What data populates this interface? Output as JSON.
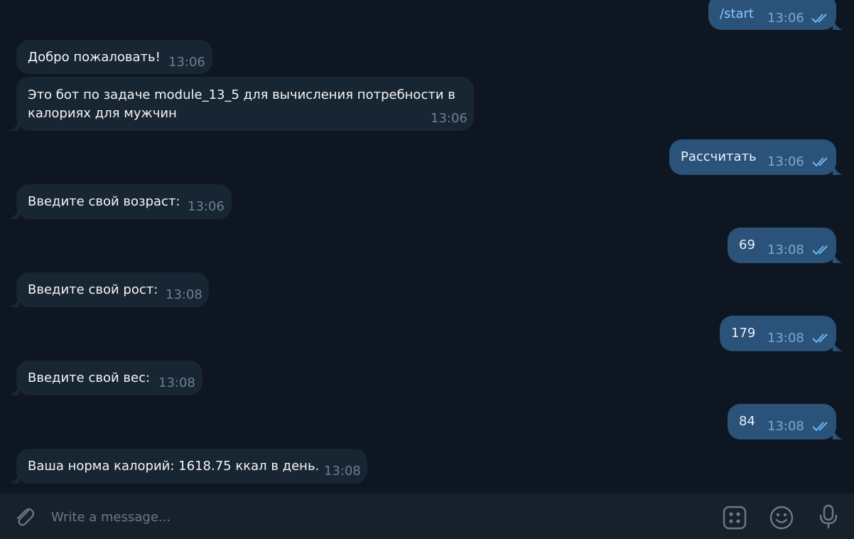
{
  "messages": [
    {
      "id": "m1",
      "dir": "out",
      "text": "/start",
      "time": "13:06",
      "is_command": true
    },
    {
      "id": "m2",
      "dir": "in",
      "text": "Добро пожаловать!",
      "time": "13:06"
    },
    {
      "id": "m3",
      "dir": "in",
      "line1": "Это бот по задаче module_13_5 для вычисления потребности в",
      "line2": "калориях для мужчин",
      "time": "13:06"
    },
    {
      "id": "m4",
      "dir": "out",
      "text": "Рассчитать",
      "time": "13:06"
    },
    {
      "id": "m5",
      "dir": "in",
      "text": "Введите свой возраст:",
      "time": "13:06"
    },
    {
      "id": "m6",
      "dir": "out",
      "text": "69",
      "time": "13:08"
    },
    {
      "id": "m7",
      "dir": "in",
      "text": "Введите свой рост:",
      "time": "13:08"
    },
    {
      "id": "m8",
      "dir": "out",
      "text": "179",
      "time": "13:08"
    },
    {
      "id": "m9",
      "dir": "in",
      "text": "Введите свой вес:",
      "time": "13:08"
    },
    {
      "id": "m10",
      "dir": "out",
      "text": "84",
      "time": "13:08"
    },
    {
      "id": "m11",
      "dir": "in",
      "text": "Ваша норма калорий: 1618.75 ккал в день.",
      "time": "13:08"
    }
  ],
  "composer": {
    "placeholder": "Write a message...",
    "value": "",
    "icons": [
      "paperclip-icon",
      "sticker-panel-icon",
      "emoji-icon",
      "microphone-icon"
    ]
  },
  "colors": {
    "background": "#0e1621",
    "incoming_bubble": "#182533",
    "outgoing_bubble": "#2b5278",
    "composer": "#17212b",
    "read_check": "#6cb6f5"
  }
}
